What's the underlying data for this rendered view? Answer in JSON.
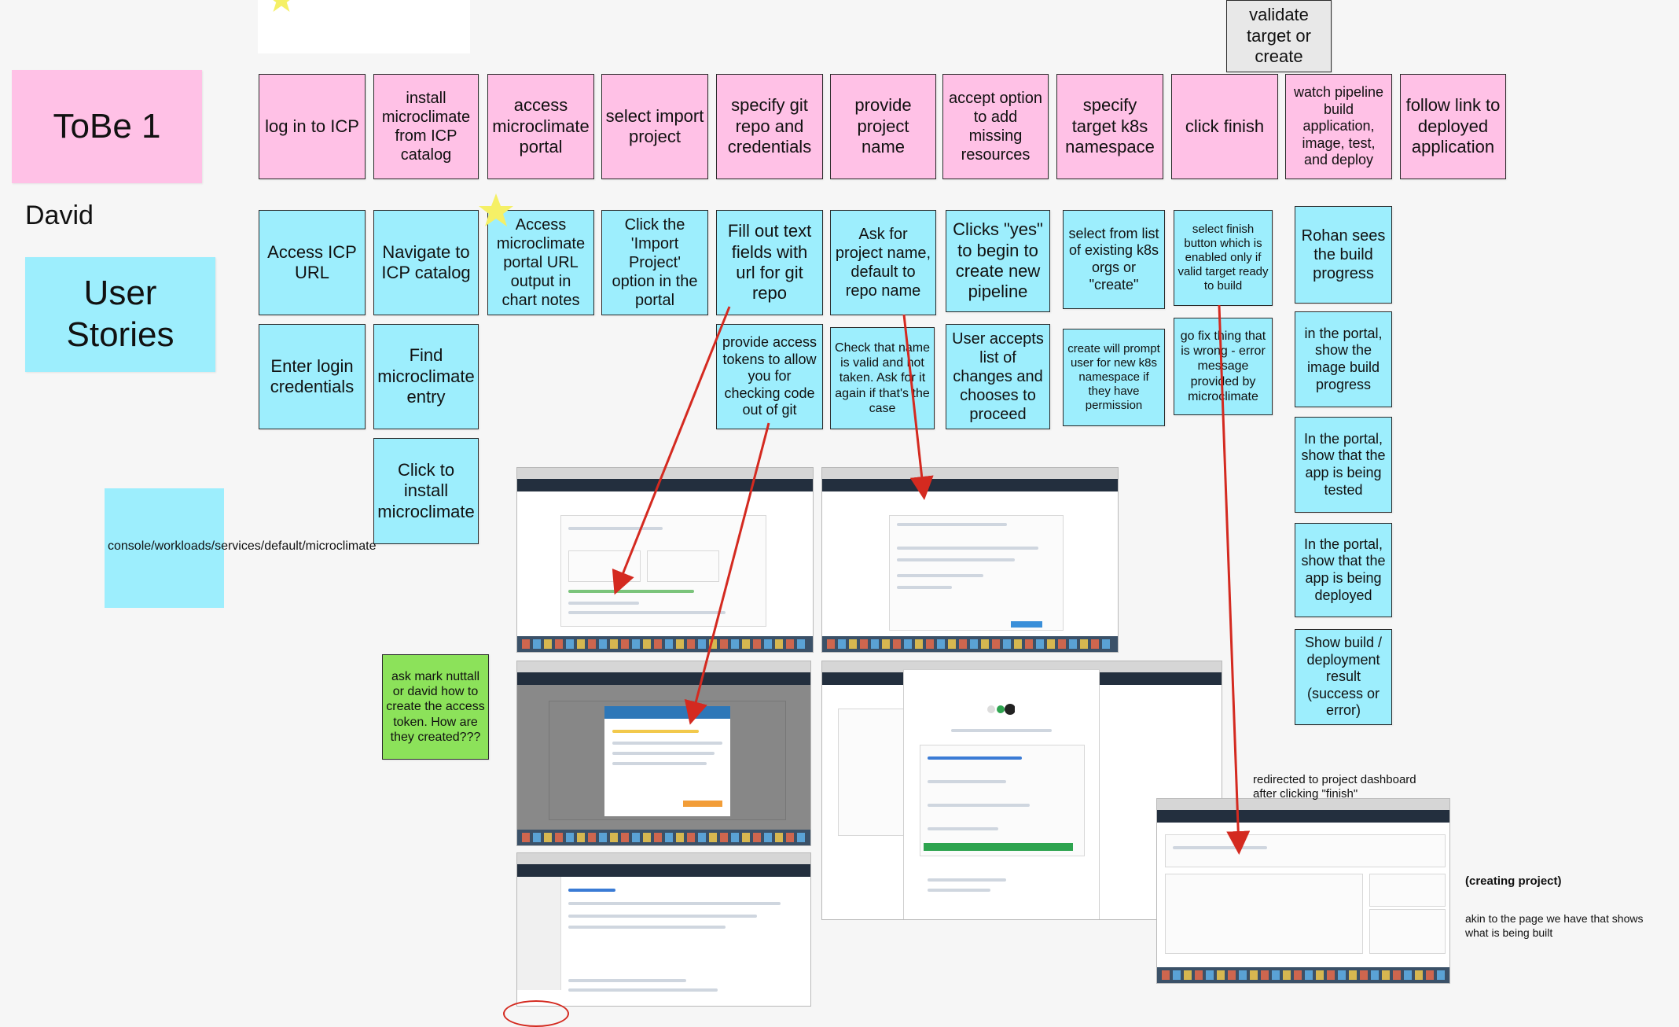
{
  "header": {
    "tobe_title": "ToBe 1",
    "persona_name": "David",
    "user_stories_title": "User Stories"
  },
  "tobe_steps": [
    "log in to ICP",
    "install microclimate from ICP catalog",
    "access microclimate portal",
    "select import project",
    "specify git repo and credentials",
    "provide project name",
    "accept option to add missing resources",
    "specify target k8s namespace",
    "click finish",
    "watch pipeline build application, image, test, and deploy",
    "follow link to deployed application"
  ],
  "validate_note": "validate target or create",
  "stories": {
    "s1": "Access ICP URL",
    "s2": "Enter login credentials",
    "s3": "Navigate to ICP catalog",
    "s4": "Find microclimate entry",
    "s5": "Click to install microclimate",
    "s6": "Access microclimate portal URL output in chart notes",
    "s7": "Click the 'Import Project' option in the portal",
    "s8": "Fill out text fields with url for git repo",
    "s9": "provide access tokens to allow you for checking code out of git",
    "s10": "Ask for project name, default to repo name",
    "s11": "Check that name is valid and not taken. Ask for it again if that's the case",
    "s12": "Clicks \"yes\" to begin to create new pipeline",
    "s13": "User accepts list of changes and chooses to proceed",
    "s14": "select from list of existing k8s orgs or \"create\"",
    "s15": "create will prompt user for new k8s namespace if they have permission",
    "s16": "select finish button which is enabled only if valid target ready to build",
    "s17": "go fix thing that is wrong - error message provided by microclimate",
    "s18": "Rohan sees the build progress",
    "s19": "in the portal, show the image build progress",
    "s20": "In the portal, show that the app is being tested",
    "s21": "In the portal, show that the app is being deployed",
    "s22": "Show build / deployment result (success or error)"
  },
  "console_path": "console/workloads/services/default/microclimate",
  "question_note": "ask mark nuttall or david how to create the access token. How are they created???",
  "annotations": {
    "redirect": "redirected to project dashboard after clicking \"finish\"",
    "creating": "(creating project)",
    "akin": "akin to the page we have that shows what is being built"
  },
  "colors": {
    "tobe": "#ffc1e6",
    "story": "#9deefd",
    "question": "#8ce25a",
    "arrow": "#d42a20",
    "star": "#f5f066"
  }
}
